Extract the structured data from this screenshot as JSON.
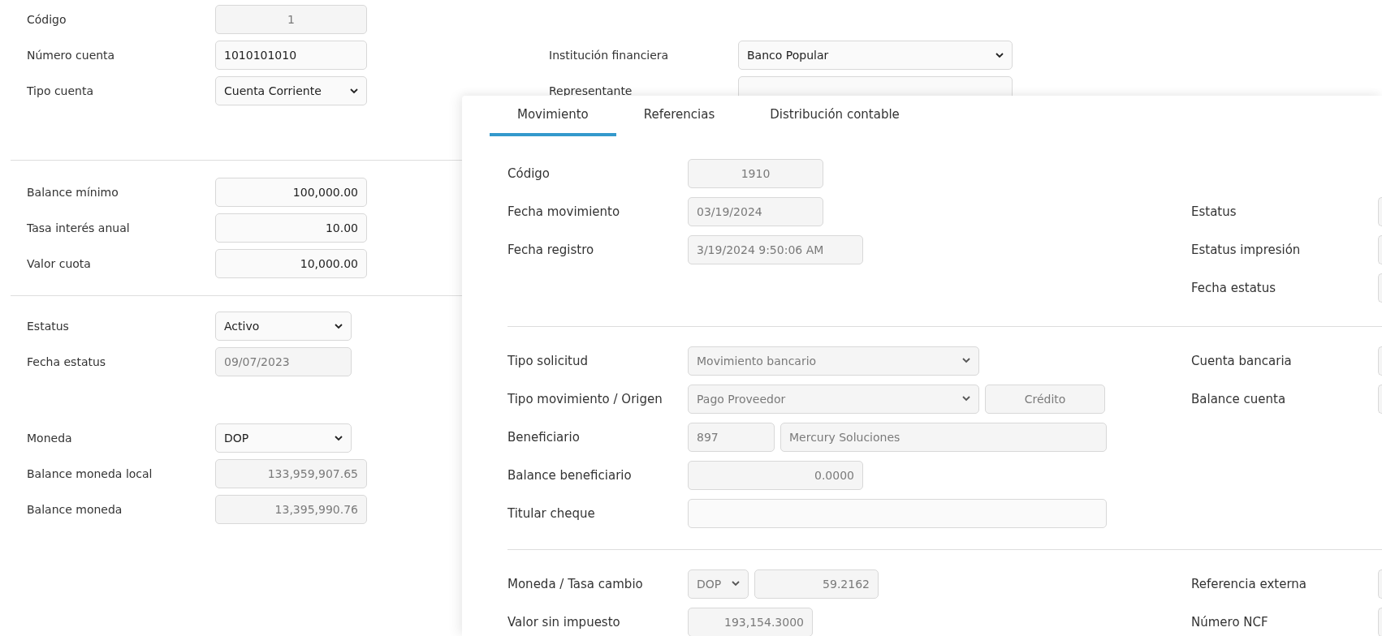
{
  "account_form": {
    "sections": [
      {
        "rows": [
          {
            "label": "Código",
            "fields": [
              {
                "kind": "input",
                "value": "1",
                "disabled": true
              }
            ]
          },
          {
            "label": "Número cuenta",
            "fields": [
              {
                "kind": "input",
                "value": "1010101010",
                "disabled": false
              }
            ]
          },
          {
            "label": "Tipo cuenta",
            "fields": [
              {
                "kind": "select",
                "value": "Cuenta Corriente",
                "disabled": false
              }
            ]
          }
        ]
      },
      {
        "rows": [
          {
            "label": "Balance mínimo",
            "fields": [
              {
                "kind": "input",
                "value": "100,000.00",
                "disabled": false
              }
            ]
          },
          {
            "label": "Tasa interés anual",
            "fields": [
              {
                "kind": "input",
                "value": "10.00",
                "disabled": false
              }
            ]
          },
          {
            "label": "Valor cuota",
            "fields": [
              {
                "kind": "input",
                "value": "10,000.00",
                "disabled": false
              }
            ]
          }
        ]
      },
      {
        "rows": [
          {
            "label": "Estatus",
            "fields": [
              {
                "kind": "select",
                "value": "Activo",
                "disabled": false
              }
            ]
          },
          {
            "label": "Fecha estatus",
            "fields": [
              {
                "kind": "input",
                "value": "09/07/2023",
                "disabled": true
              }
            ]
          }
        ]
      },
      {
        "rows": [
          {
            "label": "Moneda",
            "fields": [
              {
                "kind": "select",
                "value": "DOP",
                "disabled": false
              }
            ]
          },
          {
            "label": "Balance moneda local",
            "fields": [
              {
                "kind": "input",
                "value": "133,959,907.65",
                "disabled": true
              }
            ]
          },
          {
            "label": "Balance moneda",
            "fields": [
              {
                "kind": "input",
                "value": "13,395,990.76",
                "disabled": true
              }
            ]
          }
        ]
      }
    ]
  },
  "bank_info": {
    "rows": [
      {
        "label": "Institución financiera",
        "fields": [
          {
            "kind": "select",
            "value": "Banco Popular",
            "disabled": false
          }
        ]
      },
      {
        "label": "Representante",
        "fields": [
          {
            "kind": "input"
          }
        ]
      }
    ]
  },
  "movement_dialog": {
    "tabs": [
      {
        "label": "Movimiento",
        "selected": true
      },
      {
        "label": "Referencias",
        "selected": false
      },
      {
        "label": "Distribución contable",
        "selected": false
      }
    ],
    "sections": [
      {
        "left": [
          {
            "label": "Código",
            "fields": [
              {
                "kind": "input",
                "value": "1910",
                "disabled": true
              }
            ]
          },
          {
            "label": "Fecha movimiento",
            "fields": [
              {
                "kind": "input",
                "value": "03/19/2024",
                "disabled": true
              }
            ]
          },
          {
            "label": "Fecha registro",
            "fields": [
              {
                "kind": "input",
                "value": "3/19/2024 9:50:06 AM",
                "disabled": true
              }
            ]
          }
        ],
        "right": [
          {
            "label": "Estatus"
          },
          {
            "label": "Estatus impresión"
          },
          {
            "label": "Fecha estatus"
          }
        ]
      },
      {
        "left": [
          {
            "label": "Tipo solicitud",
            "fields": [
              {
                "kind": "select",
                "value": "Movimiento bancario",
                "disabled": true
              }
            ]
          },
          {
            "label": "Tipo movimiento / Origen",
            "fields": [
              {
                "kind": "select",
                "value": "Pago Proveedor",
                "disabled": true
              },
              {
                "kind": "input",
                "value": "Crédito",
                "disabled": true
              }
            ]
          },
          {
            "label": "Beneficiario",
            "fields": [
              {
                "kind": "input",
                "value": "897",
                "disabled": true
              },
              {
                "kind": "input",
                "value": "Mercury Soluciones",
                "disabled": true
              }
            ]
          },
          {
            "label": "Balance beneficiario",
            "fields": [
              {
                "kind": "input",
                "value": "0.0000",
                "disabled": true
              }
            ]
          },
          {
            "label": "Titular cheque",
            "fields": [
              {
                "kind": "input"
              }
            ]
          }
        ],
        "right": [
          {
            "label": "Cuenta bancaria"
          },
          {
            "label": "Balance cuenta"
          }
        ]
      },
      {
        "left": [
          {
            "label": "Moneda / Tasa cambio",
            "fields": [
              {
                "kind": "select",
                "value": "DOP",
                "disabled": true
              },
              {
                "kind": "input",
                "value": "59.2162",
                "disabled": true
              }
            ]
          },
          {
            "label": "Valor sin impuesto",
            "fields": [
              {
                "kind": "input",
                "value": "193,154.3000",
                "disabled": true
              }
            ]
          }
        ],
        "right": [
          {
            "label": "Referencia externa"
          },
          {
            "label": "Número NCF"
          }
        ]
      }
    ]
  }
}
